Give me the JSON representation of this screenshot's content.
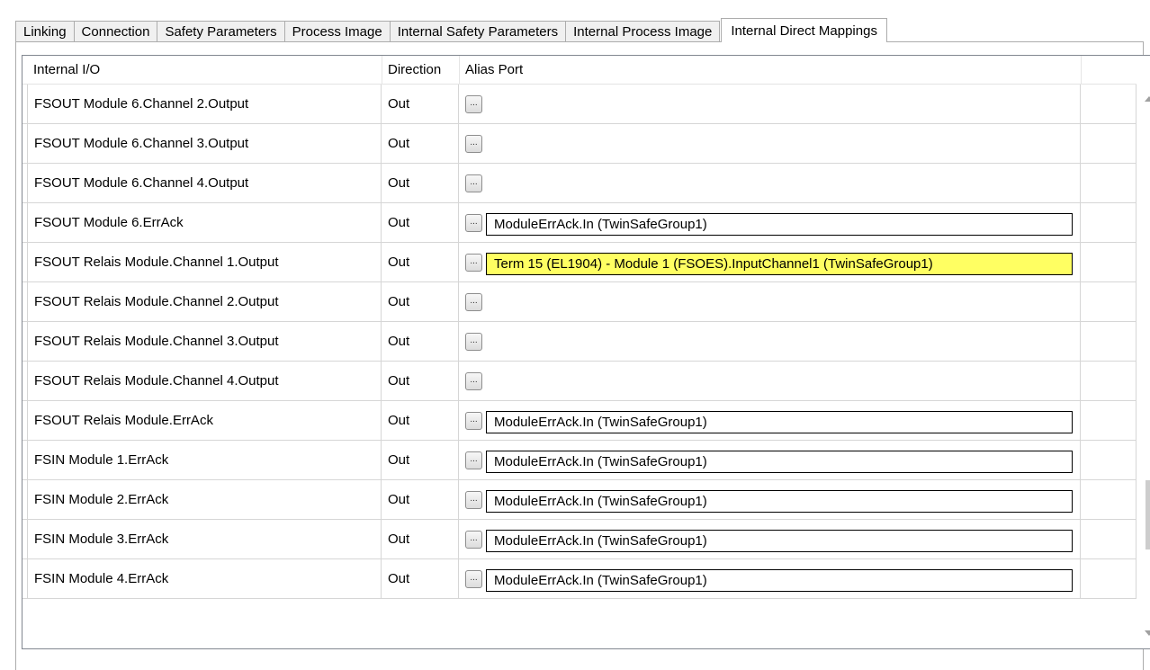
{
  "tabs": [
    {
      "label": "Linking"
    },
    {
      "label": "Connection"
    },
    {
      "label": "Safety Parameters"
    },
    {
      "label": "Process Image"
    },
    {
      "label": "Internal Safety Parameters"
    },
    {
      "label": "Internal Process Image"
    },
    {
      "label": "Internal Direct Mappings",
      "active": true
    }
  ],
  "grid": {
    "columns": [
      "Internal I/O",
      "Direction",
      "Alias Port"
    ],
    "edit_button_label": "...",
    "highlight_color": "#ffff62",
    "rows": [
      {
        "io": "FSOUT Module 6.Channel 2.Output",
        "direction": "Out",
        "alias": ""
      },
      {
        "io": "FSOUT Module 6.Channel 3.Output",
        "direction": "Out",
        "alias": ""
      },
      {
        "io": "FSOUT Module 6.Channel 4.Output",
        "direction": "Out",
        "alias": ""
      },
      {
        "io": "FSOUT Module 6.ErrAck",
        "direction": "Out",
        "alias": "ModuleErrAck.In (TwinSafeGroup1)"
      },
      {
        "io": "FSOUT Relais Module.Channel 1.Output",
        "direction": "Out",
        "alias": "Term 15 (EL1904) - Module 1 (FSOES).InputChannel1 (TwinSafeGroup1)",
        "highlighted": true
      },
      {
        "io": "FSOUT Relais Module.Channel 2.Output",
        "direction": "Out",
        "alias": ""
      },
      {
        "io": "FSOUT Relais Module.Channel 3.Output",
        "direction": "Out",
        "alias": ""
      },
      {
        "io": "FSOUT Relais Module.Channel 4.Output",
        "direction": "Out",
        "alias": ""
      },
      {
        "io": "FSOUT Relais Module.ErrAck",
        "direction": "Out",
        "alias": "ModuleErrAck.In (TwinSafeGroup1)"
      },
      {
        "io": "FSIN Module 1.ErrAck",
        "direction": "Out",
        "alias": "ModuleErrAck.In (TwinSafeGroup1)"
      },
      {
        "io": "FSIN Module 2.ErrAck",
        "direction": "Out",
        "alias": "ModuleErrAck.In (TwinSafeGroup1)"
      },
      {
        "io": "FSIN Module 3.ErrAck",
        "direction": "Out",
        "alias": "ModuleErrAck.In (TwinSafeGroup1)"
      },
      {
        "io": "FSIN Module 4.ErrAck",
        "direction": "Out",
        "alias": "ModuleErrAck.In (TwinSafeGroup1)"
      }
    ]
  },
  "scrollbar": {
    "up_icon": "scroll-up-arrow-icon",
    "down_icon": "scroll-down-arrow-icon",
    "position_fraction": 0.85
  }
}
